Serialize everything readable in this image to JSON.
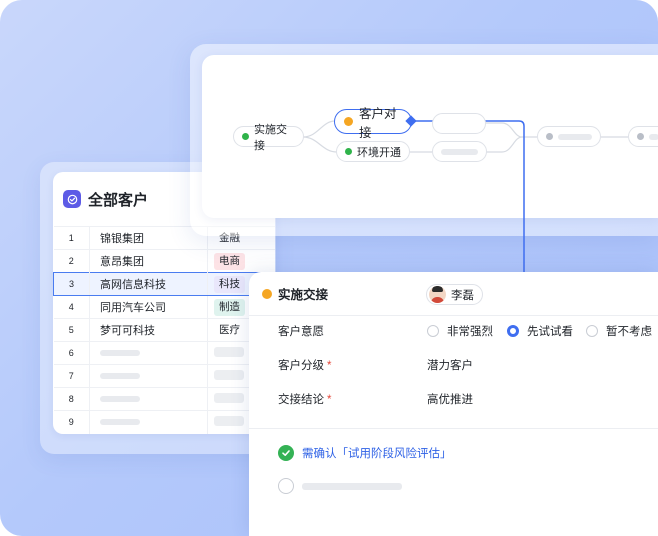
{
  "colors": {
    "accent": "#3f6ef0",
    "green_dot": "#2fb34a",
    "orange_dot": "#f5a623",
    "gray_dot": "#b9bec7"
  },
  "customers": {
    "title": "全部客户",
    "icon": "checkbadge-icon",
    "rows": [
      {
        "num": "1",
        "name": "锦银集团",
        "tag": "金融",
        "tag_bg": "#ffffff",
        "tag_color": "#1f2329"
      },
      {
        "num": "2",
        "name": "意昂集团",
        "tag": "电商",
        "tag_bg": "#fde3e6",
        "tag_color": "#1f2329"
      },
      {
        "num": "3",
        "name": "高网信息科技",
        "tag": "科技",
        "tag_bg": "#e9e7fb",
        "tag_color": "#1f2329"
      },
      {
        "num": "4",
        "name": "同用汽车公司",
        "tag": "制造",
        "tag_bg": "#dff3ee",
        "tag_color": "#1f2329"
      },
      {
        "num": "5",
        "name": "梦可可科技",
        "tag": "医疗",
        "tag_bg": "#ffffff",
        "tag_color": "#1f2329"
      },
      {
        "num": "6",
        "name": "",
        "tag": ""
      },
      {
        "num": "7",
        "name": "",
        "tag": ""
      },
      {
        "num": "8",
        "name": "",
        "tag": ""
      },
      {
        "num": "9",
        "name": "",
        "tag": ""
      }
    ]
  },
  "flow": {
    "node_start": "实施交接",
    "node_active": "客户对接",
    "node_env": "环境开通"
  },
  "detail": {
    "title": "实施交接",
    "assignee": "李磊",
    "fields": {
      "intent_label": "客户意愿",
      "intent_options": [
        "非常强烈",
        "先试试看",
        "暂不考虑"
      ],
      "intent_selected": "先试试看",
      "tier_label": "客户分级",
      "tier_value": "潜力客户",
      "conclusion_label": "交接结论",
      "conclusion_value": "高优推进",
      "required_mark": "*"
    },
    "tasks": {
      "confirm_text": "需确认「试用阶段风险评估」"
    }
  }
}
